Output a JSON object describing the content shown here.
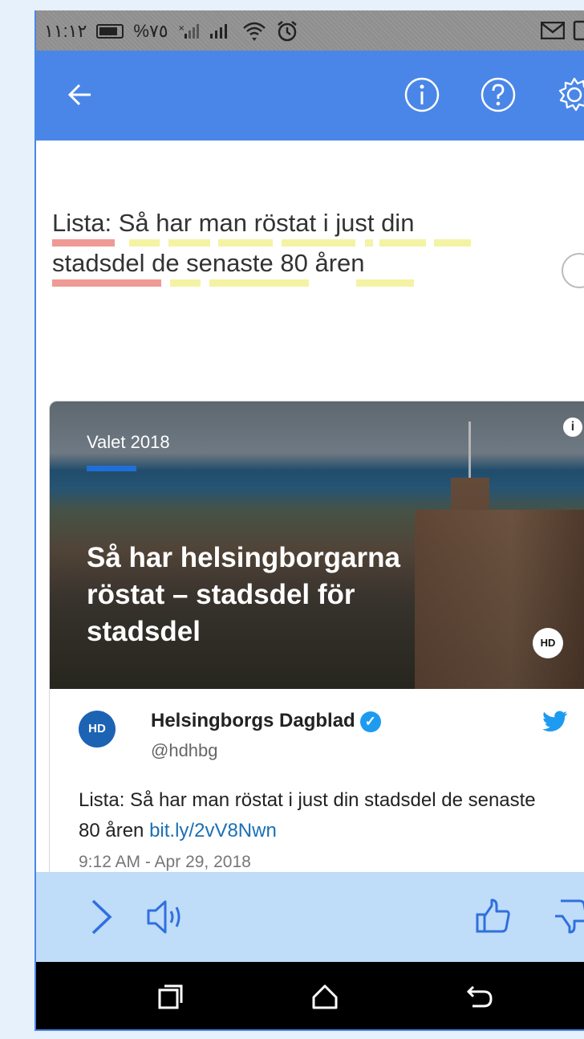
{
  "status_bar": {
    "time": "١١:١٢",
    "battery_percent": "%٧٥"
  },
  "app_bar": {
    "back_icon": "arrow-left-icon",
    "info_icon": "info-circle-icon",
    "help_icon": "question-circle-icon",
    "settings_icon": "gear-icon"
  },
  "headline": {
    "line1": "Lista: Så har man röstat i just din",
    "line2": "stadsdel de senaste 80 åren"
  },
  "card": {
    "kicker": "Valet 2018",
    "title": "Så har helsingborgarna röstat – stadsdel för stadsdel",
    "logo_text": "HD",
    "tweet": {
      "avatar_text": "HD",
      "name": "Helsingborgs Dagblad",
      "handle": "@hdhbg",
      "text": "Lista: Så har man röstat i just din stadsdel de senaste 80 åren ",
      "link": "bit.ly/2vV8Nwn",
      "time": "9:12 AM - Apr 29, 2018"
    }
  },
  "colors": {
    "accent": "#4a86e8",
    "action_bar": "#bfdcf8",
    "highlight_red": "#ef9a95",
    "highlight_yellow": "#f4f3a3"
  }
}
